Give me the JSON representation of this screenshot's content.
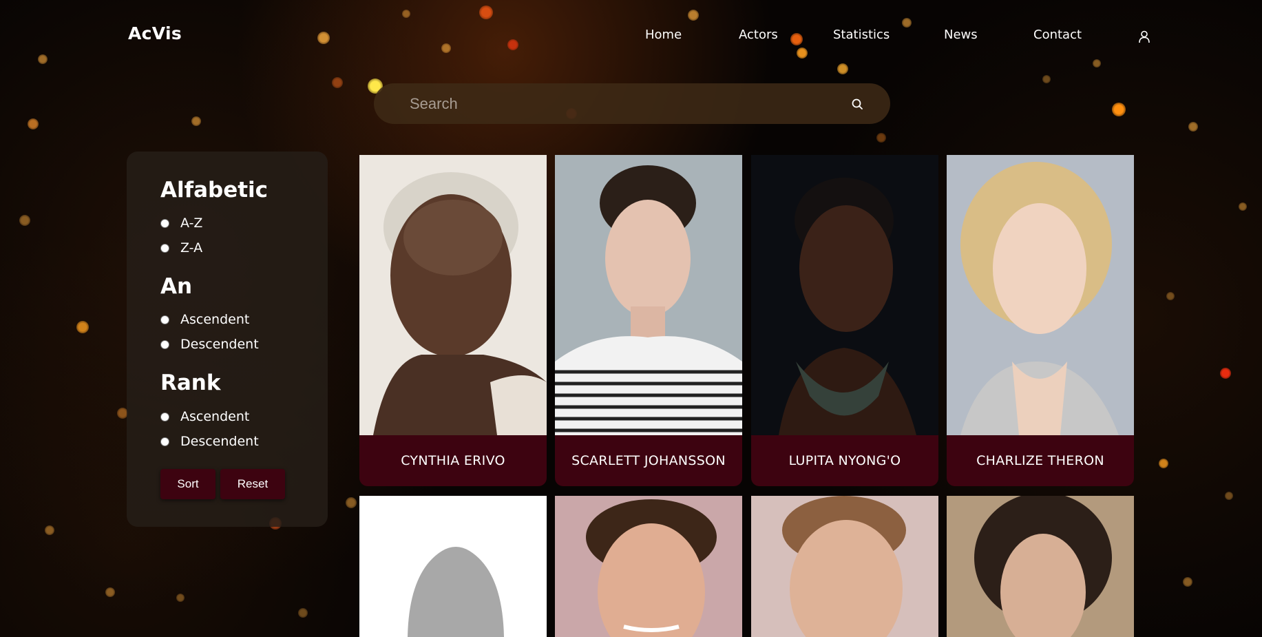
{
  "app": {
    "title": "AcVis"
  },
  "nav": {
    "items": [
      "Home",
      "Actors",
      "Statistics",
      "News",
      "Contact"
    ],
    "account_icon": "user-icon"
  },
  "search": {
    "placeholder": "Search",
    "value": "",
    "icon": "search-icon"
  },
  "filters": {
    "groups": [
      {
        "title": "Alfabetic",
        "options": [
          "A-Z",
          "Z-A"
        ]
      },
      {
        "title": "An",
        "options": [
          "Ascendent",
          "Descendent"
        ]
      },
      {
        "title": "Rank",
        "options": [
          "Ascendent",
          "Descendent"
        ]
      }
    ],
    "sort_label": "Sort",
    "reset_label": "Reset"
  },
  "actors": [
    {
      "name": "CYNTHIA ERIVO"
    },
    {
      "name": "SCARLETT JOHANSSON"
    },
    {
      "name": "LUPITA NYONG'O"
    },
    {
      "name": "CHARLIZE THERON"
    },
    {
      "name": ""
    },
    {
      "name": ""
    },
    {
      "name": ""
    },
    {
      "name": ""
    }
  ],
  "colors": {
    "accent": "#3d0310",
    "panel": "#261e18",
    "search_bg": "#3e2a16"
  }
}
